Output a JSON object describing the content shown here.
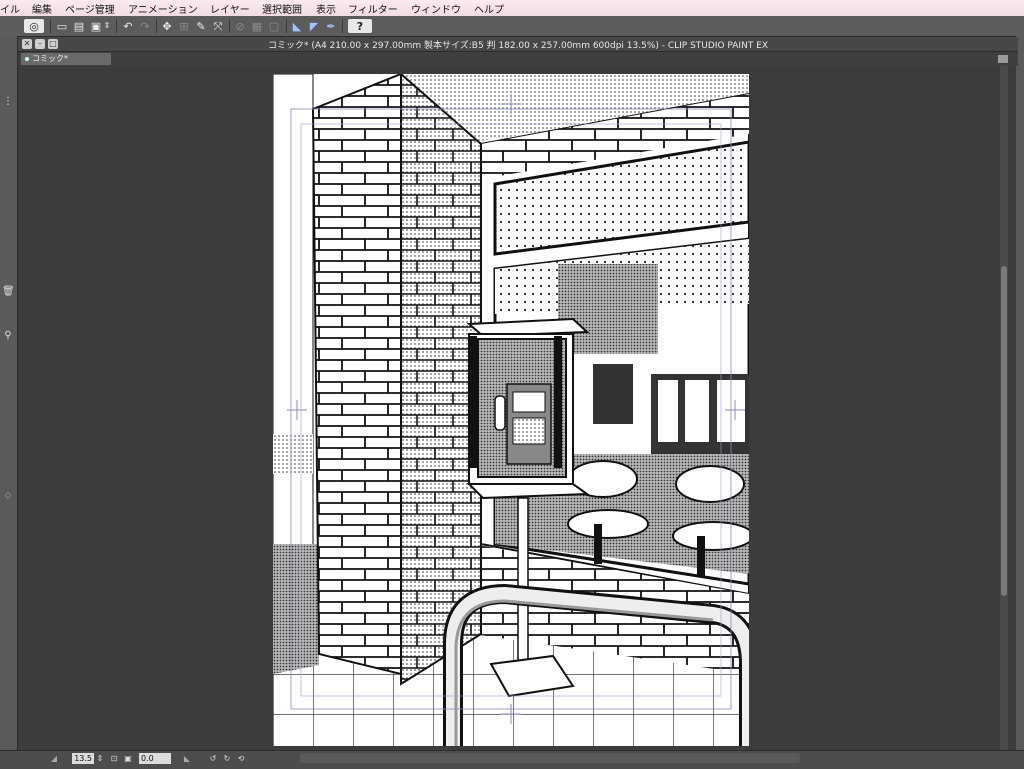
{
  "menubar": {
    "items": [
      "イル",
      "編集",
      "ページ管理",
      "アニメーション",
      "レイヤー",
      "選択範囲",
      "表示",
      "フィルター",
      "ウィンドウ",
      "ヘルプ"
    ]
  },
  "toolbar": {
    "icons": [
      "app-logo-icon",
      "new-file-icon",
      "open-file-icon",
      "save-icon",
      "undo-icon",
      "redo-icon",
      "transform-icon",
      "deselect-icon",
      "fill-icon",
      "ruler-icon",
      "perspective-ruler-icon",
      "snap-icon",
      "pen-pressure-icon",
      "help-icon"
    ]
  },
  "window": {
    "title": "コミック* (A4 210.00 x 297.00mm 製本サイズ:B5 判 182.00 x 257.00mm 600dpi 13.5%)  - CLIP STUDIO PAINT EX",
    "tab_label": "コミック*"
  },
  "status": {
    "zoom": "13.5",
    "rotation": "0.0"
  },
  "colors": {
    "menubar_bg": "#f1dce4",
    "workspace_bg": "#3c3c3c",
    "panel_bg": "#5a5a5a",
    "canvas_bg": "#ffffff"
  }
}
